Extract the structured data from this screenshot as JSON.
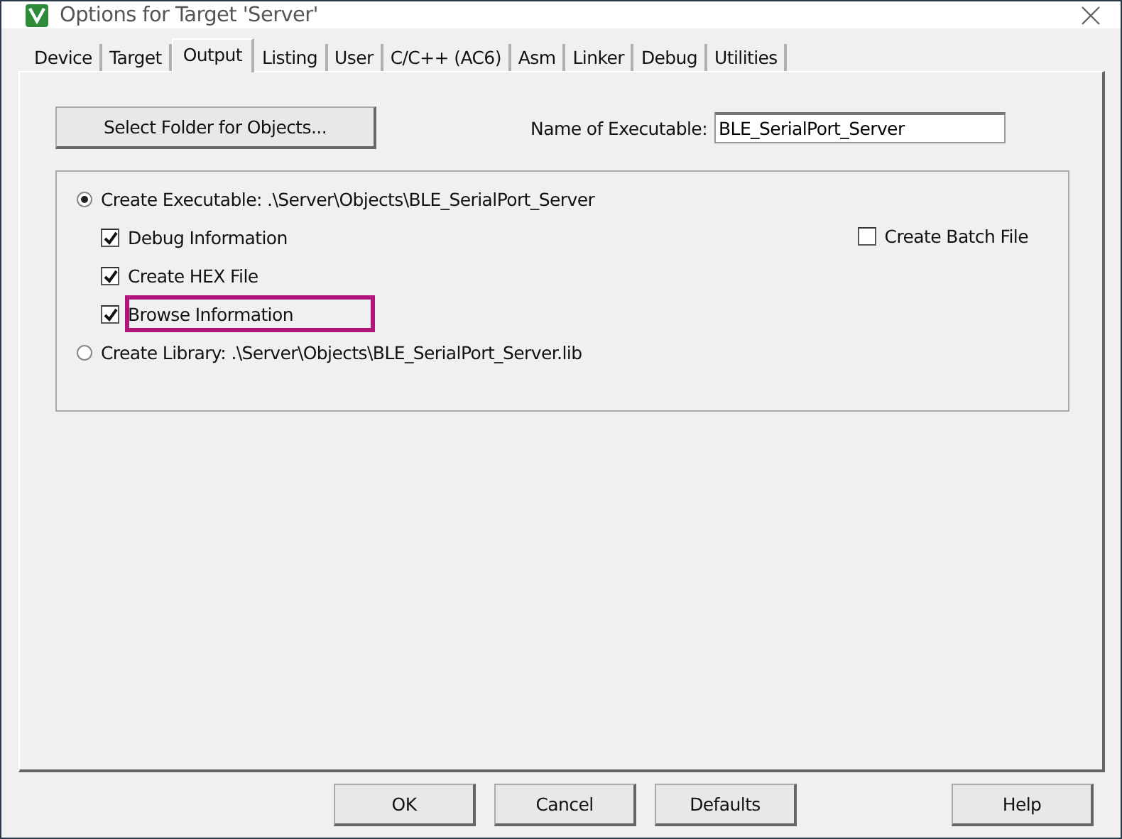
{
  "window": {
    "title": "Options for Target 'Server'"
  },
  "tabs": [
    {
      "label": "Device",
      "selected": false
    },
    {
      "label": "Target",
      "selected": false
    },
    {
      "label": "Output",
      "selected": true
    },
    {
      "label": "Listing",
      "selected": false
    },
    {
      "label": "User",
      "selected": false
    },
    {
      "label": "C/C++ (AC6)",
      "selected": false
    },
    {
      "label": "Asm",
      "selected": false
    },
    {
      "label": "Linker",
      "selected": false
    },
    {
      "label": "Debug",
      "selected": false
    },
    {
      "label": "Utilities",
      "selected": false
    }
  ],
  "select_folder_button": "Select Folder for Objects...",
  "executable_name": {
    "label": "Name of Executable:",
    "value": "BLE_SerialPort_Server"
  },
  "create_executable": {
    "label": "Create Executable:  .\\Server\\Objects\\BLE_SerialPort_Server",
    "selected": true
  },
  "options": [
    {
      "label": "Debug Information",
      "checked": true,
      "highlighted": false
    },
    {
      "label": "Create HEX File",
      "checked": true,
      "highlighted": false
    },
    {
      "label": "Browse Information",
      "checked": true,
      "highlighted": true
    }
  ],
  "create_batch_file": {
    "label": "Create Batch File",
    "checked": false
  },
  "create_library": {
    "label": "Create Library:  .\\Server\\Objects\\BLE_SerialPort_Server.lib",
    "selected": false
  },
  "buttons": [
    "OK",
    "Cancel",
    "Defaults",
    "Help"
  ]
}
